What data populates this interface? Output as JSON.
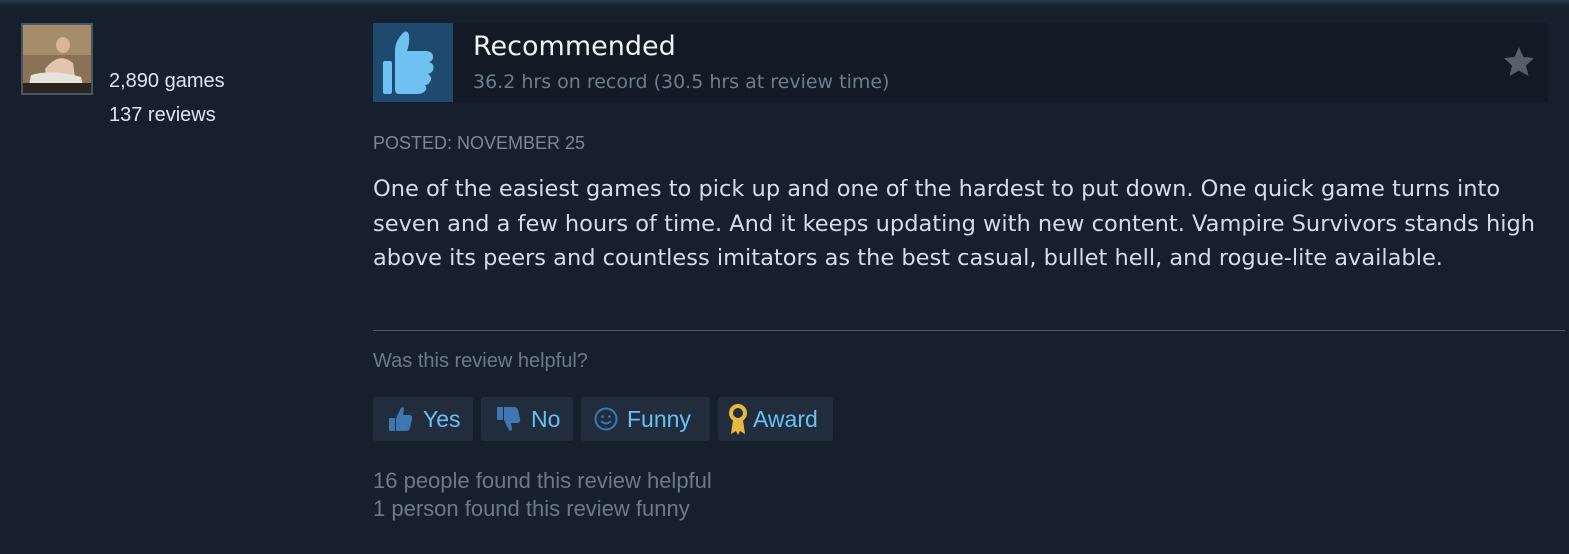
{
  "reviewer": {
    "games_count": "2,890 games",
    "reviews_count": "137 reviews"
  },
  "review": {
    "verdict": "Recommended",
    "hours": "36.2 hrs on record (30.5 hrs at review time)",
    "posted": "POSTED: NOVEMBER 25",
    "body": "One of the easiest games to pick up and one of the hardest to put down. One quick game turns into seven and a few hours of time. And it keeps updating with new content. Vampire Survivors stands high above its peers and countless imitators as the best casual, bullet hell, and rogue-lite available."
  },
  "feedback": {
    "question": "Was this review helpful?",
    "buttons": {
      "yes": "Yes",
      "no": "No",
      "funny": "Funny",
      "award": "Award"
    },
    "helpful_count": "16 people found this review helpful",
    "funny_count": "1 person found this review funny"
  },
  "icons": {
    "verdict": "thumbs-up-icon",
    "favorite": "star-icon",
    "yes": "thumbs-up-icon",
    "no": "thumbs-down-icon",
    "funny": "smiley-icon",
    "award": "award-ribbon-icon"
  },
  "colors": {
    "background": "#16202d",
    "link": "#67c1f5",
    "thumb_box": "#1f4a70",
    "thumb": "#6ec1f0",
    "award": "#e8b83c"
  }
}
